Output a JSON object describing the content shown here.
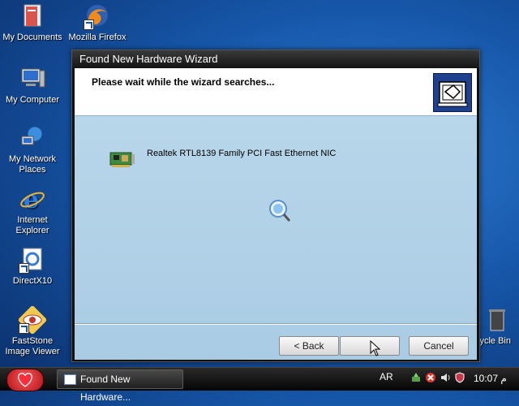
{
  "desktop": {
    "icons": [
      {
        "label_line1": "My Documents",
        "label_line2": ""
      },
      {
        "label_line1": "Mozilla Firefox",
        "label_line2": ""
      },
      {
        "label_line1": "My Computer",
        "label_line2": ""
      },
      {
        "label_line1": "My Network",
        "label_line2": "Places"
      },
      {
        "label_line1": "Internet",
        "label_line2": "Explorer"
      },
      {
        "label_line1": "DirectX10",
        "label_line2": ""
      },
      {
        "label_line1": "FastStone",
        "label_line2": "Image Viewer"
      },
      {
        "label_line1": "ycle Bin",
        "label_line2": ""
      }
    ]
  },
  "wizard": {
    "title": "Found New Hardware Wizard",
    "header_text": "Please wait while the wizard searches...",
    "device_name": "Realtek RTL8139 Family PCI Fast Ethernet NIC",
    "buttons": {
      "back": "< Back",
      "next": "",
      "cancel": "Cancel"
    }
  },
  "taskbar": {
    "task_label": "Found New Hardware...",
    "language": "AR",
    "clock": "10:07 م"
  },
  "colors": {
    "desktop": "#1656a8",
    "taskbar": "#111111",
    "wizard_body": "#b2d2e8",
    "start_orb": "#d42a2a"
  }
}
